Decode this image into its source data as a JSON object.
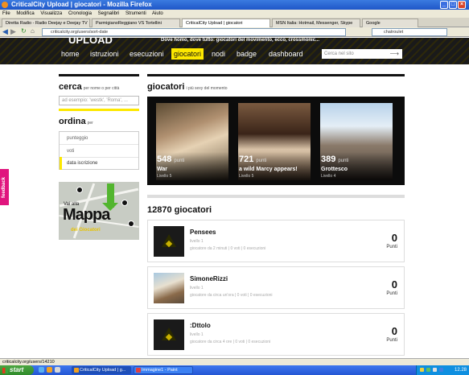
{
  "window": {
    "title": "CriticalCity Upload | giocatori - Mozilla Firefox"
  },
  "menu": [
    "File",
    "Modifica",
    "Visualizza",
    "Cronologia",
    "Segnalibri",
    "Strumenti",
    "Aiuto"
  ],
  "tabs": [
    {
      "label": "Diretta Radio - Radio Deejay e Deejay TV"
    },
    {
      "label": "ParmigianoReggiano VS Tortellini"
    },
    {
      "label": "CriticalCity Upload | giocatori"
    },
    {
      "label": "MSN Italia: Hotmail, Messenger, Skype"
    },
    {
      "label": "Google"
    }
  ],
  "address": {
    "url": "criticalcity.org/users/sort-date"
  },
  "websearch": {
    "value": "chatroulet"
  },
  "header": {
    "logo": "UPLOAD",
    "slogan": "Dove homo, dove tutto: giocatori del movimento, ecco, crossmonic...",
    "nav": [
      "home",
      "istruzioni",
      "esecuzioni",
      "giocatori",
      "nodi",
      "badge",
      "dashboard"
    ],
    "active_nav": "giocatori",
    "search_placeholder": "Cerca nel sito"
  },
  "sidebar": {
    "cerca_title": "cerca",
    "cerca_sub": "per nome o per città",
    "cerca_placeholder": "ad esempio: 'westk', 'Roma', ...",
    "ordina_title": "ordina",
    "ordina_sub": "per",
    "ordina_options": [
      "punteggio",
      "voti",
      "data iscrizione"
    ],
    "map_vai": "Vai alla",
    "map_title": "Mappa",
    "map_sub": "dei Giocatori"
  },
  "feedback_label": "feedback",
  "main": {
    "title": "giocatori",
    "subtitle": "i più sexy del momento",
    "featured": [
      {
        "points": "548",
        "points_unit": "punti",
        "name": "War",
        "level": "Livello 5"
      },
      {
        "points": "721",
        "points_unit": "punti",
        "name": "a wild Marcy appears!",
        "level": "Livello 5"
      },
      {
        "points": "389",
        "points_unit": "punti",
        "name": "Grottesco",
        "level": "Livello 4"
      }
    ],
    "count_title": "12870 giocatori",
    "players": [
      {
        "name": "Pensees",
        "level": "livello 1",
        "info": "giocatore da 2 minuti | 0 voti | 0 esecuzioni",
        "points": "0",
        "points_label": "Punti"
      },
      {
        "name": "SimoneRizzi",
        "level": "livello 1",
        "info": "giocatore da circa un'ora | 0 voti | 0 esecuzioni",
        "points": "0",
        "points_label": "Punti"
      },
      {
        "name": ":Dttolo",
        "level": "livello 1",
        "info": "giocatore da circa 4 ore | 0 voti | 0 esecuzioni",
        "points": "0",
        "points_label": "Punti"
      }
    ]
  },
  "status": {
    "text": "criticalcity.org/users/14210"
  },
  "taskbar": {
    "start": "start",
    "buttons": [
      "CriticalCity Upload | g...",
      "Immagine1 - Paint"
    ],
    "clock": "12.28"
  }
}
